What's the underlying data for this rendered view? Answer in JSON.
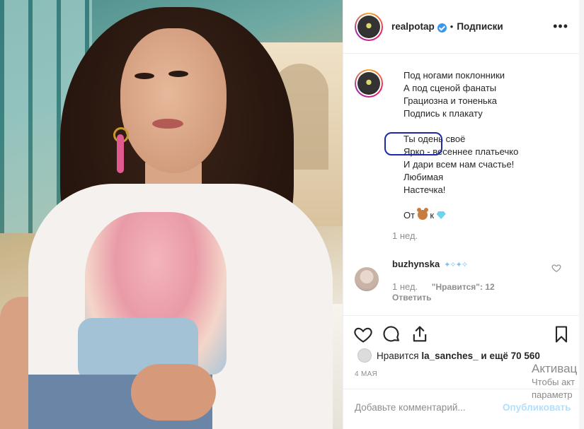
{
  "post": {
    "username": "realpotap",
    "separator": "•",
    "follow_label": "Подписки",
    "more_label": "•••",
    "caption_lines_1": [
      "Под ногами поклонники",
      "А под сценой фанаты",
      "Грациозна и тоненька",
      "Подпись к плакату"
    ],
    "caption_lines_2": [
      "Ты одень своё",
      "Ярко - весеннее платьечко",
      "И дари всем нам счастье!",
      "Любимая",
      "Настечка!"
    ],
    "from_prefix": "От",
    "from_to": "к",
    "caption_time": "1 нед."
  },
  "comment": {
    "username": "buzhynska",
    "time": "1 нед.",
    "likes": "\"Нравится\": 12",
    "reply_label": "Ответить"
  },
  "likes": {
    "prefix": "Нравится",
    "user": "la_sanches_",
    "suffix": "и ещё 70 560"
  },
  "date": "4 МАЯ",
  "comment_box": {
    "placeholder": "Добавьте комментарий...",
    "publish_label": "Опубликовать"
  },
  "watermark": {
    "line1": "Активац",
    "line2": "Чтобы акт",
    "line3": "параметр"
  },
  "colors": {
    "accent_blue": "#3897f0",
    "annotation_outline": "#1d2aa8",
    "muted_text": "#8e8e8e"
  }
}
